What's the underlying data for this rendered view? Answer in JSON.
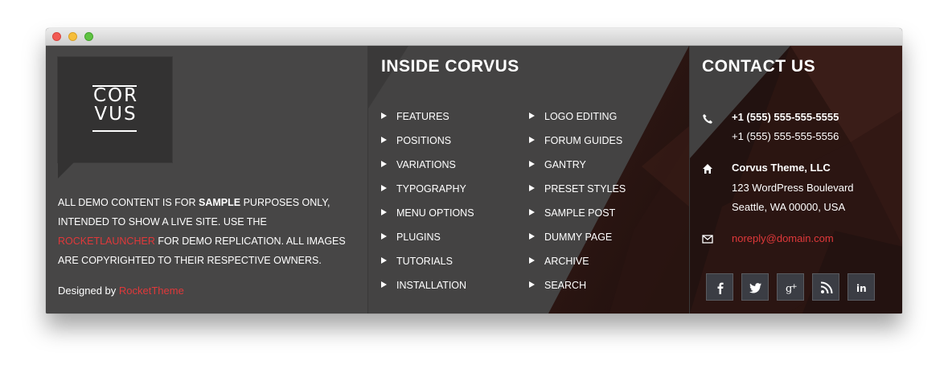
{
  "window": {
    "controls": [
      "close",
      "minimize",
      "zoom"
    ]
  },
  "about": {
    "logo": {
      "line1": "COR",
      "line2": "VUS"
    },
    "text_part1": "All demo content is for ",
    "text_bold": "sample",
    "text_part2": " purposes only, intended to show a live site. Use the ",
    "text_link": "RocketLauncher",
    "text_part3": " for demo replication. All images are copyrighted to their respective owners.",
    "designed_prefix": "Designed by",
    "designed_link": "RocketTheme"
  },
  "inside": {
    "title": "Inside Corvus",
    "col1": [
      "Features",
      "Positions",
      "Variations",
      "Typography",
      "Menu Options",
      "Plugins",
      "Tutorials",
      "Installation"
    ],
    "col2": [
      "Logo Editing",
      "Forum Guides",
      "Gantry",
      "Preset Styles",
      "Sample Post",
      "Dummy Page",
      "Archive",
      "Search"
    ]
  },
  "contact": {
    "title": "Contact Us",
    "phone1": "+1 (555) 555-555-5555",
    "phone2": "+1 (555) 555-555-5556",
    "company": "Corvus Theme, LLC",
    "address1": "123 WordPress Boulevard",
    "address2": "Seattle, WA 00000, USA",
    "email": "noreply@domain.com",
    "social": [
      "facebook-icon",
      "twitter-icon",
      "google-plus-icon",
      "rss-icon",
      "linkedin-icon"
    ]
  },
  "colors": {
    "accent": "#e0383a",
    "background": "#474646",
    "dark_red": "#2a1512"
  }
}
